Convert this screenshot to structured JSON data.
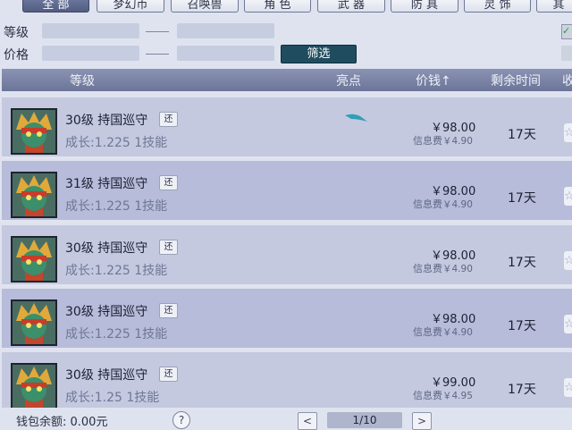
{
  "tabs": [
    "全 部",
    "梦幻币",
    "召唤兽",
    "角 色",
    "武 器",
    "防 具",
    "灵 饰",
    "其"
  ],
  "filter": {
    "level_label": "等级",
    "price_label": "价格",
    "button_label": "筛选",
    "right_check": "✓"
  },
  "table": {
    "headers": {
      "level": "等级",
      "highlight": "亮点",
      "price": "价钱",
      "price_sort": "↑",
      "remaining": "剩余时间",
      "favorite": "收"
    },
    "rows": [
      {
        "name": "30级 持国巡守",
        "badge": "还",
        "growth": "成长:1.225 1技能",
        "price": "￥98.00",
        "fee_label": "信息费",
        "fee": "￥4.90",
        "time": "17天"
      },
      {
        "name": "31级 持国巡守",
        "badge": "还",
        "growth": "成长:1.225 1技能",
        "price": "￥98.00",
        "fee_label": "信息费",
        "fee": "￥4.90",
        "time": "17天"
      },
      {
        "name": "30级 持国巡守",
        "badge": "还",
        "growth": "成长:1.225 1技能",
        "price": "￥98.00",
        "fee_label": "信息费",
        "fee": "￥4.90",
        "time": "17天"
      },
      {
        "name": "30级 持国巡守",
        "badge": "还",
        "growth": "成长:1.225 1技能",
        "price": "￥98.00",
        "fee_label": "信息费",
        "fee": "￥4.90",
        "time": "17天"
      },
      {
        "name": "30级 持国巡守",
        "badge": "还",
        "growth": "成长:1.25 1技能",
        "price": "￥99.00",
        "fee_label": "信息费",
        "fee": "￥4.95",
        "time": "17天"
      }
    ]
  },
  "footer": {
    "wallet": "钱包余额: 0.00元",
    "help": "?",
    "prev": "<",
    "page": "1/10",
    "next": ">"
  },
  "colors": {
    "header_bg": "#7a83a6",
    "row_bg": "#c4c9e0",
    "row_alt_bg": "#b6bcd9",
    "filter_button": "#1f4d5f",
    "active_tab": "#5d6890"
  }
}
